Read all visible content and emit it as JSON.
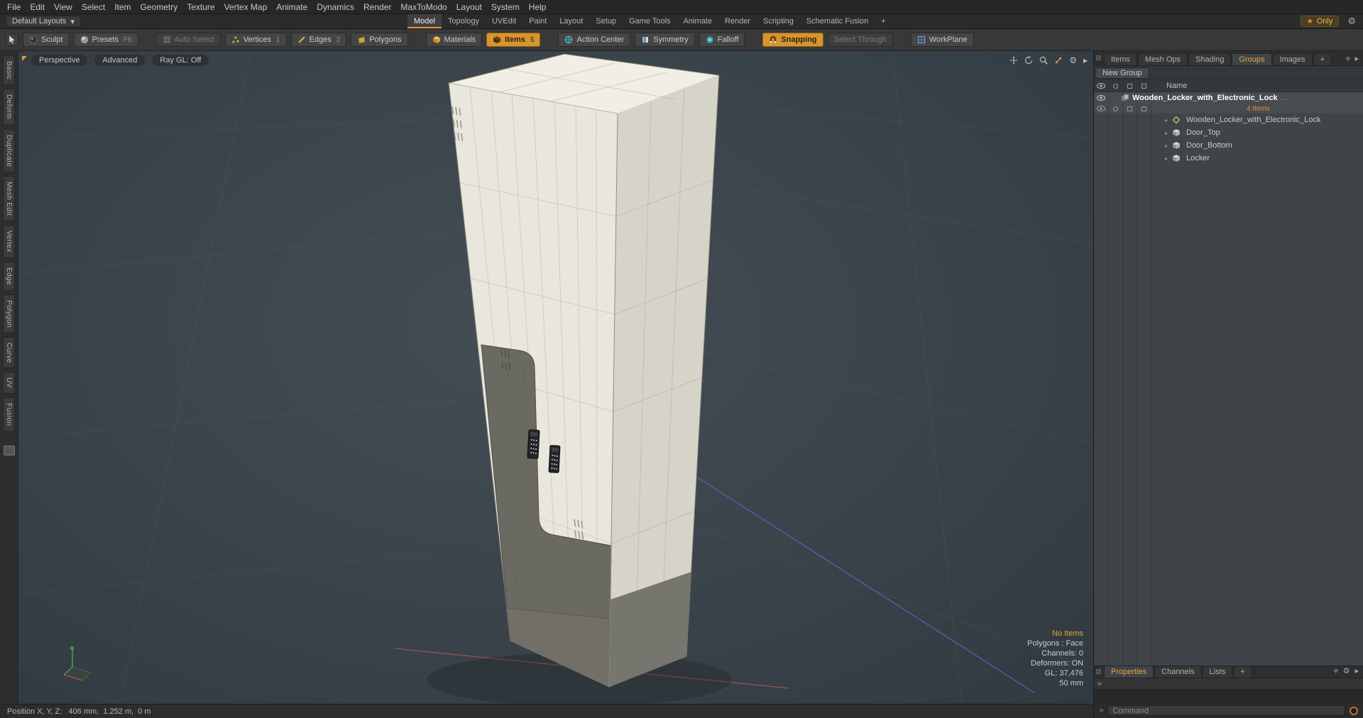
{
  "icons": {
    "gear": "⚙",
    "star": "★",
    "caret_down": "▾",
    "chevron_right": "▸",
    "double_chevron": "»",
    "dots": "...",
    "plus": "+"
  },
  "menubar": {
    "items": [
      "File",
      "Edit",
      "View",
      "Select",
      "Item",
      "Geometry",
      "Texture",
      "Vertex Map",
      "Animate",
      "Dynamics",
      "Render",
      "MaxToModo",
      "Layout",
      "System",
      "Help"
    ]
  },
  "layoutbar": {
    "layouts_dropdown": "Default Layouts",
    "tabs": [
      "Model",
      "Topology",
      "UVEdit",
      "Paint",
      "Layout",
      "Setup",
      "Game Tools",
      "Animate",
      "Render",
      "Scripting",
      "Schematic Fusion",
      "+"
    ],
    "active_tab": "Model",
    "only_label": "Only"
  },
  "toolbar": {
    "sculpt": "Sculpt",
    "presets": "Presets",
    "presets_key": "F6",
    "auto_select": "Auto Select",
    "vertices": "Vertices",
    "vertices_key": "1",
    "edges": "Edges",
    "edges_key": "2",
    "polygons": "Polygons",
    "materials": "Materials",
    "items": "Items",
    "items_key": "5",
    "action_center": "Action Center",
    "symmetry": "Symmetry",
    "falloff": "Falloff",
    "snapping": "Snapping",
    "select_through": "Select Through",
    "workplane": "WorkPlane"
  },
  "left_tabs": [
    "Basic",
    "Deform",
    "Duplicate",
    "Mesh Edit",
    "Vertex",
    "Edge",
    "Polygon",
    "Curve",
    "UV",
    "Fusion"
  ],
  "viewport": {
    "mode": "Perspective",
    "style": "Advanced",
    "raygl": "Ray GL: Off",
    "info": [
      "No Items",
      "Polygons : Face",
      "Channels: 0",
      "Deformers: ON",
      "GL: 37,476",
      "50 mm"
    ]
  },
  "statusbar": {
    "position": "Position X, Y, Z:   406 mm,  1.252 m,  0 m"
  },
  "right_panel": {
    "tabs": [
      "Items",
      "Mesh Ops",
      "Shading",
      "Groups",
      "Images",
      "+"
    ],
    "active_tab": "Groups",
    "new_group": "New Group",
    "name_header": "Name",
    "group_name": "Wooden_Locker_with_Electronic_Lock",
    "group_suffix": "...",
    "group_count": "4 Items",
    "children": [
      "Wooden_Locker_with_Electronic_Lock",
      "Door_Top",
      "Door_Bottom",
      "Locker"
    ],
    "bottom_tabs": [
      "Properties",
      "Channels",
      "Lists",
      "+"
    ],
    "active_bottom_tab": "Properties",
    "command_prompt": ">",
    "command_placeholder": "Command"
  }
}
